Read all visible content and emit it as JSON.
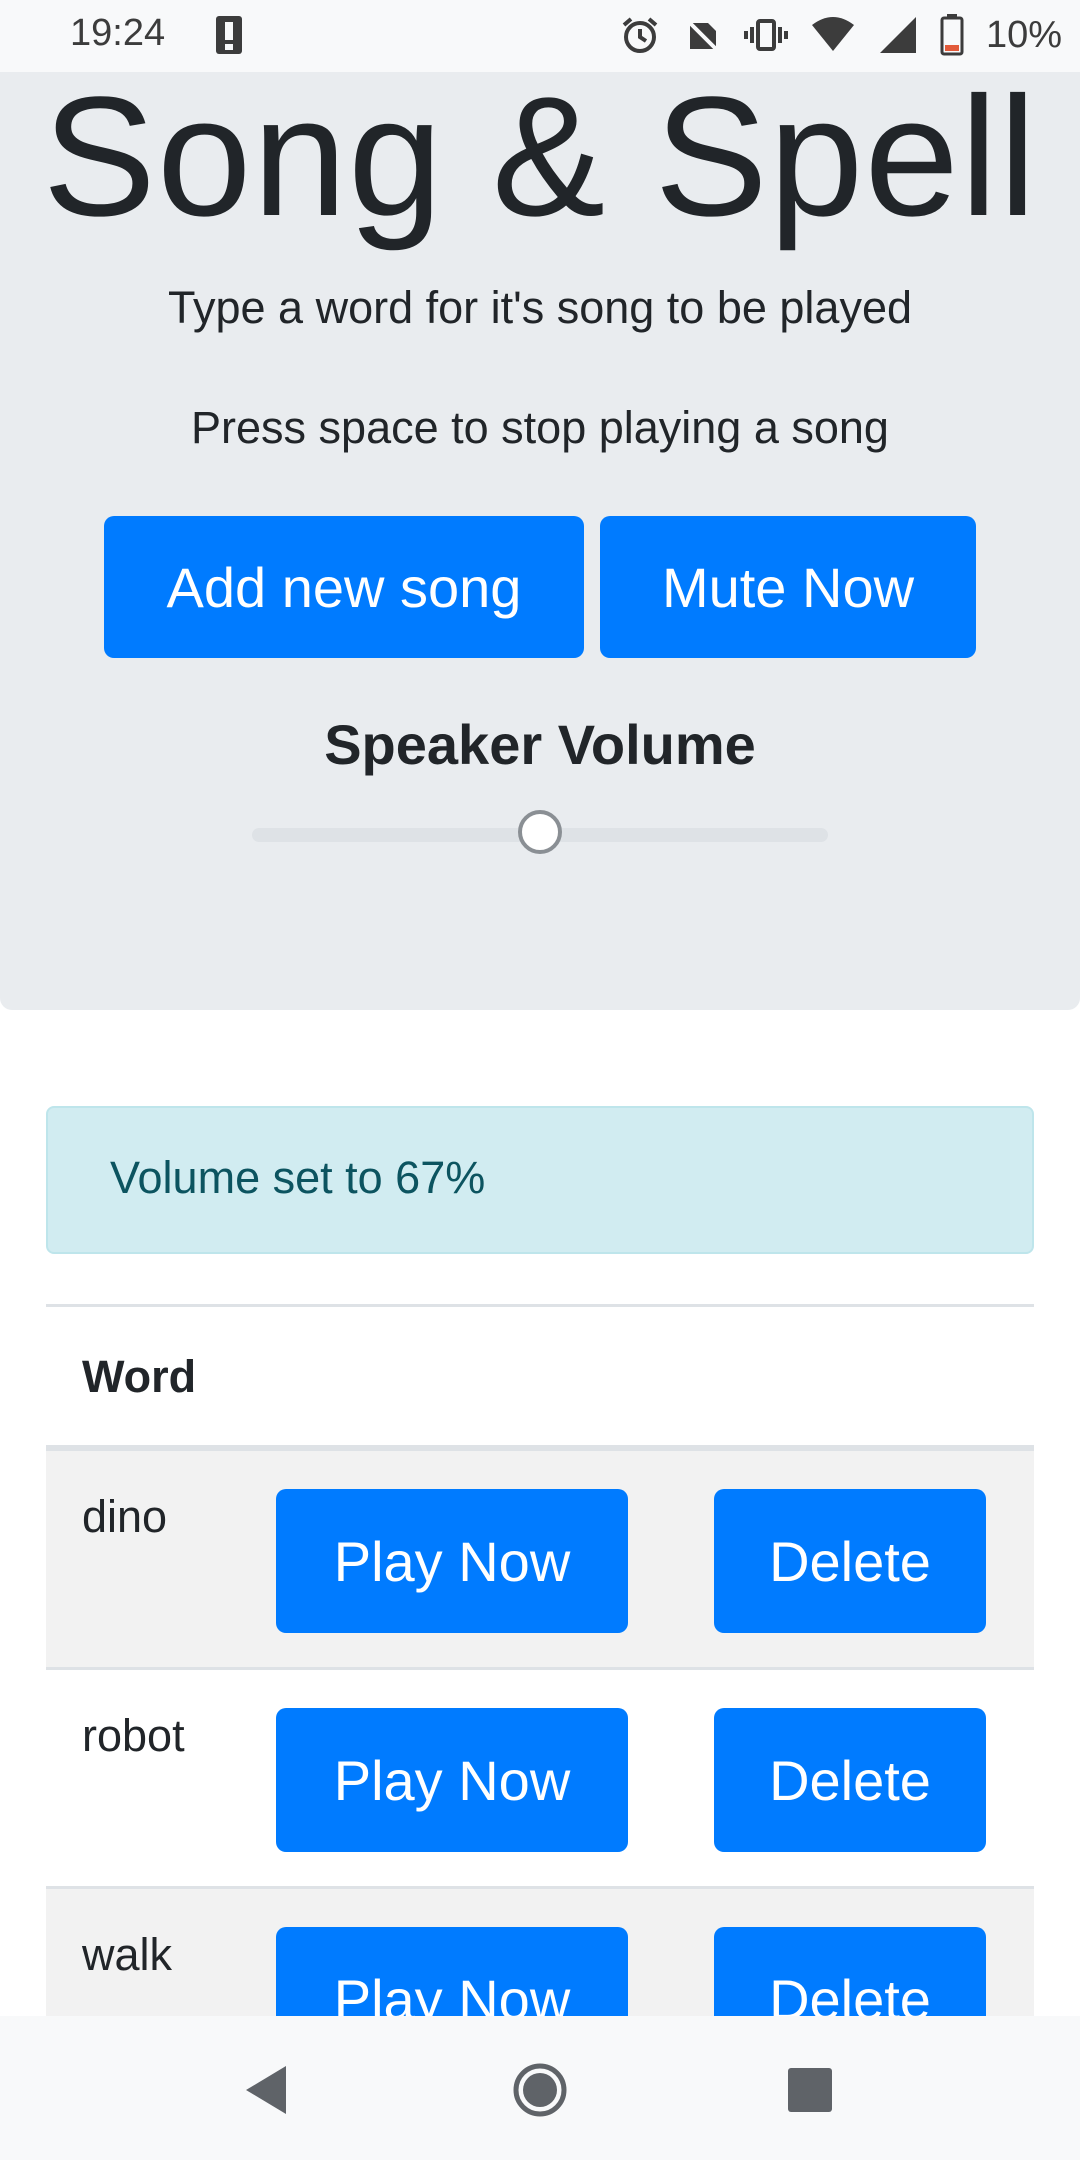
{
  "status_bar": {
    "time": "19:24",
    "battery": "10%"
  },
  "header": {
    "title": "Song & Spell",
    "instruction_1": "Type a word for it's song to be played",
    "instruction_2": "Press space to stop playing a song",
    "add_song_label": "Add new song",
    "mute_label": "Mute Now",
    "volume_label": "Speaker Volume",
    "volume_level": 0.5
  },
  "alert": {
    "text": "Volume set to 67%"
  },
  "table": {
    "header_word": "Word",
    "rows": [
      {
        "word": "dino",
        "play": "Play Now",
        "delete": "Delete"
      },
      {
        "word": "robot",
        "play": "Play Now",
        "delete": "Delete"
      },
      {
        "word": "walk",
        "play": "Play Now",
        "delete": "Delete"
      }
    ]
  },
  "colors": {
    "primary": "#007bff",
    "jumbotron_bg": "#e9ecef",
    "alert_bg": "#d1ecf1",
    "alert_text": "#0c5460"
  },
  "icons": [
    "alert-icon",
    "alarm-icon",
    "no-sim-icon",
    "vibrate-icon",
    "wifi-icon",
    "signal-icon",
    "battery-low-icon",
    "back-icon",
    "home-icon",
    "recents-icon"
  ]
}
